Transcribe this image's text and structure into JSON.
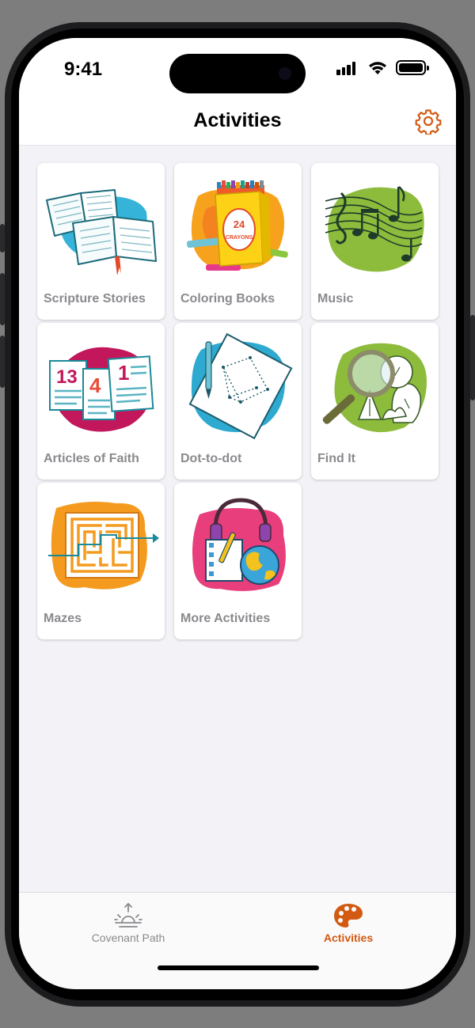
{
  "status_bar": {
    "time": "9:41"
  },
  "header": {
    "title": "Activities",
    "settings_icon": "gear-icon"
  },
  "colors": {
    "accent": "#d25a12",
    "label_gray": "#8a8a8e",
    "background": "#f2f2f7"
  },
  "activities": [
    {
      "label": "Scripture Stories",
      "icon": "open-books-icon"
    },
    {
      "label": "Coloring Books",
      "icon": "crayon-box-icon"
    },
    {
      "label": "Music",
      "icon": "music-notes-icon"
    },
    {
      "label": "Articles of Faith",
      "icon": "numbered-pages-icon"
    },
    {
      "label": "Dot-to-dot",
      "icon": "dot-to-dot-page-icon"
    },
    {
      "label": "Find It",
      "icon": "magnifying-glass-icon"
    },
    {
      "label": "Mazes",
      "icon": "maze-icon"
    },
    {
      "label": "More Activities",
      "icon": "headphones-globe-icon"
    }
  ],
  "art_text": {
    "crayon_count": "24",
    "crayon_word": "CRAYONS",
    "num_a": "13",
    "num_b": "4",
    "num_c": "1"
  },
  "tab_bar": {
    "tabs": [
      {
        "label": "Covenant Path",
        "icon": "sunrise-icon",
        "selected": false
      },
      {
        "label": "Activities",
        "icon": "palette-icon",
        "selected": true
      }
    ]
  }
}
